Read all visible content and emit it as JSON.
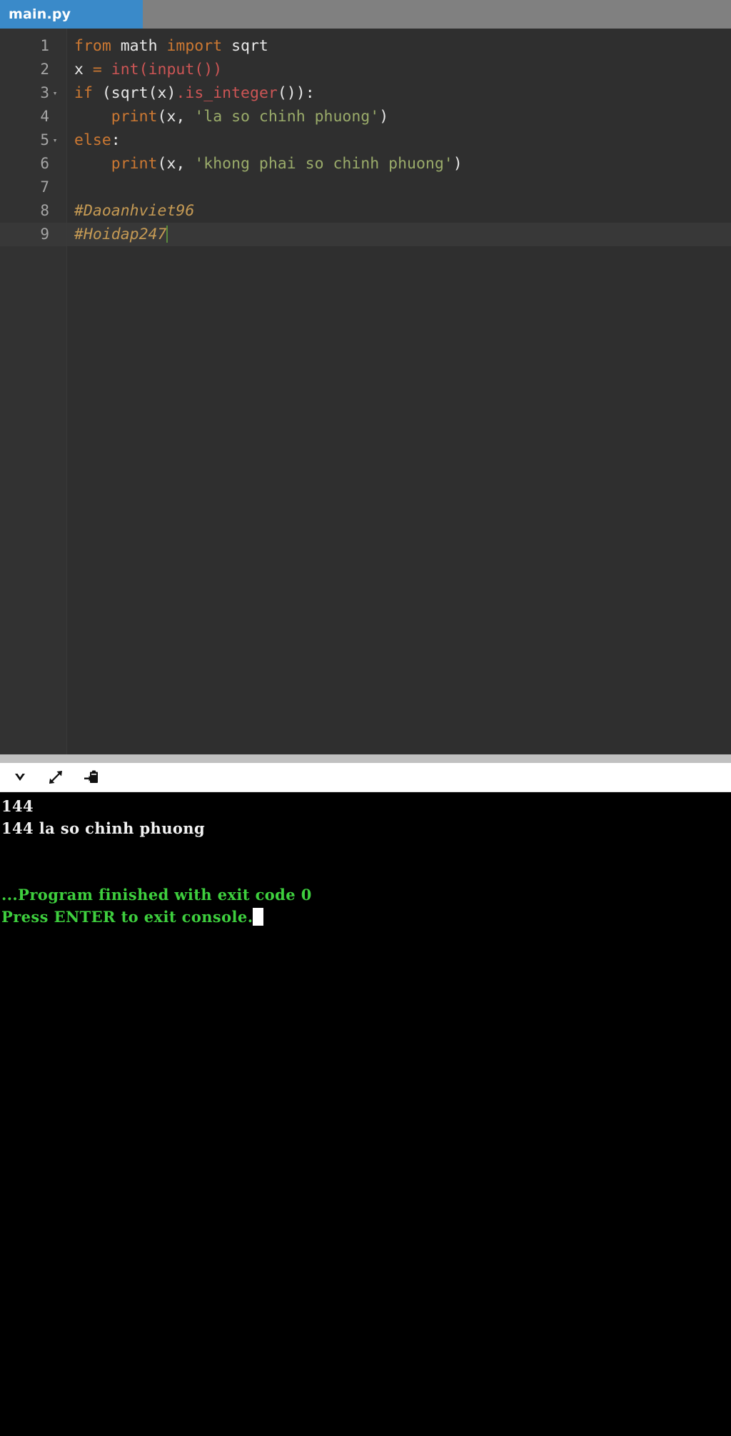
{
  "window": {
    "title": "main.py",
    "accent_tab_color": "#3a8ac9",
    "tabbar_bg": "#808080"
  },
  "tabs": [
    {
      "label": "main.py",
      "active": true
    }
  ],
  "editor": {
    "theme_bg": "#2f2f2f",
    "gutter_bg": "#323232",
    "current_line": 9,
    "lines": [
      {
        "number": "1",
        "fold": "",
        "tokens": [
          {
            "t": "from",
            "c": "k"
          },
          {
            "t": " ",
            "c": "pn"
          },
          {
            "t": "math",
            "c": "id"
          },
          {
            "t": " ",
            "c": "pn"
          },
          {
            "t": "import",
            "c": "k"
          },
          {
            "t": " ",
            "c": "pn"
          },
          {
            "t": "sqrt",
            "c": "id"
          }
        ]
      },
      {
        "number": "2",
        "fold": "",
        "tokens": [
          {
            "t": "x ",
            "c": "id"
          },
          {
            "t": "= ",
            "c": "k"
          },
          {
            "t": "int",
            "c": "bi"
          },
          {
            "t": "(",
            "c": "bi"
          },
          {
            "t": "input",
            "c": "bi"
          },
          {
            "t": "()",
            "c": "bi"
          },
          {
            "t": ")",
            "c": "bi"
          }
        ]
      },
      {
        "number": "3",
        "fold": "▾",
        "tokens": [
          {
            "t": "if",
            "c": "k"
          },
          {
            "t": " ",
            "c": "pn"
          },
          {
            "t": "(",
            "c": "pn"
          },
          {
            "t": "sqrt",
            "c": "id"
          },
          {
            "t": "(",
            "c": "pn"
          },
          {
            "t": "x",
            "c": "id"
          },
          {
            "t": ")",
            "c": "pn"
          },
          {
            "t": ".",
            "c": "bi"
          },
          {
            "t": "is_integer",
            "c": "bi"
          },
          {
            "t": "()",
            "c": "pn"
          },
          {
            "t": ")",
            "c": "pn"
          },
          {
            "t": ":",
            "c": "pn"
          }
        ]
      },
      {
        "number": "4",
        "fold": "",
        "tokens": [
          {
            "t": "    ",
            "c": "pn"
          },
          {
            "t": "print",
            "c": "fn"
          },
          {
            "t": "(",
            "c": "pn"
          },
          {
            "t": "x",
            "c": "id"
          },
          {
            "t": ", ",
            "c": "pn"
          },
          {
            "t": "'la so chinh phuong'",
            "c": "st"
          },
          {
            "t": ")",
            "c": "pn"
          }
        ]
      },
      {
        "number": "5",
        "fold": "▾",
        "tokens": [
          {
            "t": "else",
            "c": "k"
          },
          {
            "t": ":",
            "c": "pn"
          }
        ]
      },
      {
        "number": "6",
        "fold": "",
        "tokens": [
          {
            "t": "    ",
            "c": "pn"
          },
          {
            "t": "print",
            "c": "fn"
          },
          {
            "t": "(",
            "c": "pn"
          },
          {
            "t": "x",
            "c": "id"
          },
          {
            "t": ", ",
            "c": "pn"
          },
          {
            "t": "'khong phai so chinh phuong'",
            "c": "st"
          },
          {
            "t": ")",
            "c": "pn"
          }
        ]
      },
      {
        "number": "7",
        "fold": "",
        "tokens": []
      },
      {
        "number": "8",
        "fold": "",
        "tokens": [
          {
            "t": "#Daoanhviet96",
            "c": "cm"
          }
        ]
      },
      {
        "number": "9",
        "fold": "",
        "caret": true,
        "tokens": [
          {
            "t": "#Hoidap247",
            "c": "cm"
          }
        ]
      }
    ]
  },
  "console_toolbar": {
    "icons": [
      {
        "name": "chevron-down-icon",
        "title": "Collapse console"
      },
      {
        "name": "expand-arrows-icon",
        "title": "Maximize console"
      },
      {
        "name": "paste-clipboard-icon",
        "title": "Copy / paste to console"
      }
    ]
  },
  "console": {
    "bg": "#000000",
    "text_color": "#f2f2f2",
    "status_color": "#3ecf3e",
    "lines": [
      {
        "text": "144",
        "kind": "out"
      },
      {
        "text": "144 la so chinh phuong",
        "kind": "out"
      },
      {
        "text": " ",
        "kind": "blank"
      },
      {
        "text": " ",
        "kind": "blank"
      },
      {
        "text": "...Program finished with exit code 0",
        "kind": "ok"
      },
      {
        "text": "Press ENTER to exit console.",
        "kind": "ok",
        "cursor": true
      }
    ]
  }
}
